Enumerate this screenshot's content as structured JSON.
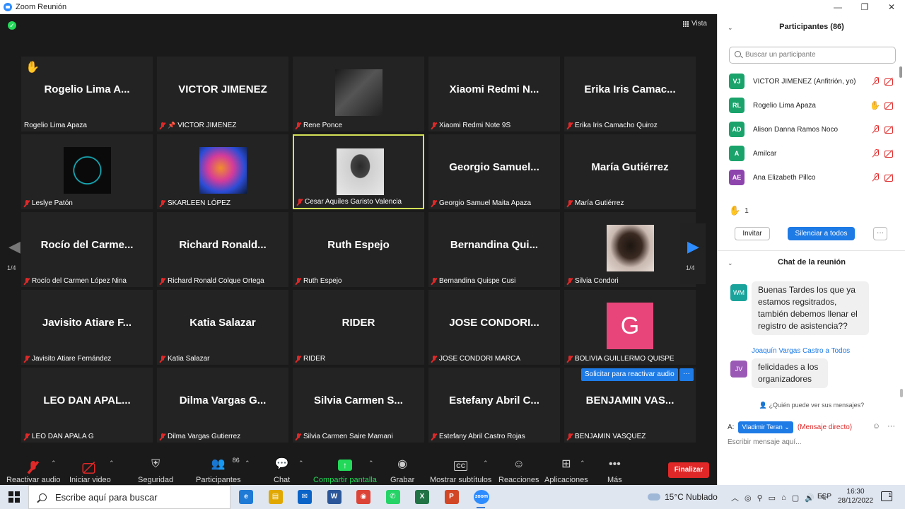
{
  "window": {
    "title": "Zoom Reunión"
  },
  "video": {
    "view_label": "Vista",
    "page_indicator": "1/4",
    "request_unmute_label": "Solicitar para reactivar audio",
    "more_label": "···",
    "tiles": [
      {
        "display": "Rogelio Lima A...",
        "caption": "Rogelio Lima Apaza",
        "muted": false,
        "hand": true
      },
      {
        "display": "VICTOR JIMENEZ",
        "caption": "VICTOR JIMENEZ",
        "muted": true,
        "pinned": true
      },
      {
        "display": "",
        "caption": "Rene Ponce",
        "muted": true,
        "photo": "guitarist"
      },
      {
        "display": "Xiaomi Redmi N...",
        "caption": "Xiaomi Redmi Note 9S",
        "muted": true
      },
      {
        "display": "Erika Iris Camac...",
        "caption": "Erika Iris Camacho Quiroz",
        "muted": true
      },
      {
        "display": "",
        "caption": "Leslye Patón",
        "muted": true,
        "photo": "logo"
      },
      {
        "display": "",
        "caption": "SKARLEEN LÓPEZ",
        "muted": true,
        "photo": "brain"
      },
      {
        "display": "",
        "caption": "Cesar Aquiles Garisto Valencia",
        "muted": true,
        "photo": "portrait",
        "active": true
      },
      {
        "display": "Georgio Samuel...",
        "caption": "Georgio Samuel Maita Apaza",
        "muted": true
      },
      {
        "display": "María Gutiérrez",
        "caption": "María Gutiérrez",
        "muted": true
      },
      {
        "display": "Rocío del Carme...",
        "caption": "Rocío del Carmen López Nina",
        "muted": true
      },
      {
        "display": "Richard  Ronald...",
        "caption": "Richard Ronald Colque Ortega",
        "muted": true
      },
      {
        "display": "Ruth Espejo",
        "caption": "Ruth Espejo",
        "muted": true
      },
      {
        "display": "Bernandina Qui...",
        "caption": "Bernandina Quispe Cusi",
        "muted": true
      },
      {
        "display": "",
        "caption": "Silvia Condori",
        "muted": true,
        "photo": "woman"
      },
      {
        "display": "Javisito  Atiare  F...",
        "caption": "Javisito Atiare Fernández",
        "muted": true
      },
      {
        "display": "Katia Salazar",
        "caption": "Katia Salazar",
        "muted": true
      },
      {
        "display": "RIDER",
        "caption": "RIDER",
        "muted": true
      },
      {
        "display": "JOSE  CONDORI...",
        "caption": "JOSE CONDORI MARCA",
        "muted": true
      },
      {
        "display": "",
        "caption": "BOLIVIA GUILLERMO QUISPE",
        "muted": true,
        "letter": "G"
      },
      {
        "display": "LEO DAN APAL...",
        "caption": "LEO DAN APALA G",
        "muted": true
      },
      {
        "display": "Dilma Vargas G...",
        "caption": "Dilma Vargas Gutierrez",
        "muted": true
      },
      {
        "display": "Silvia Carmen S...",
        "caption": "Silvia Carmen Saire Mamani",
        "muted": true
      },
      {
        "display": "Estefany Abril C...",
        "caption": "Estefany Abril Castro Rojas",
        "muted": true
      },
      {
        "display": "BENJAMIN VAS...",
        "caption": "BENJAMIN VASQUEZ",
        "muted": true
      }
    ]
  },
  "toolbar": {
    "audio": "Reactivar audio",
    "video": "Iniciar video",
    "security": "Seguridad",
    "participants": "Participantes",
    "participants_count": "86",
    "chat": "Chat",
    "share": "Compartir pantalla",
    "record": "Grabar",
    "subtitles": "Mostrar subtítulos",
    "subtitles_icon": "CC",
    "reactions": "Reacciones",
    "apps": "Aplicaciones",
    "more": "Más",
    "more_icon": "•••",
    "end": "Finalizar"
  },
  "participants_panel": {
    "title": "Participantes (86)",
    "search_placeholder": "Buscar un participante",
    "list": [
      {
        "initials": "VJ",
        "name": "VICTOR JIMENEZ (Anfitrión, yo)",
        "color": "#1aa36b",
        "hand": false
      },
      {
        "initials": "RL",
        "name": "Rogelio Lima Apaza",
        "color": "#1aa36b",
        "hand": true
      },
      {
        "initials": "AD",
        "name": "Alison Danna  Ramos Noco",
        "color": "#1aa36b",
        "hand": false
      },
      {
        "initials": "A",
        "name": "Amilcar",
        "color": "#1aa36b",
        "hand": false
      },
      {
        "initials": "AE",
        "name": "Ana Elizabeth Pillco",
        "color": "#8e44ad",
        "hand": false
      },
      {
        "initials": "",
        "name": "",
        "color": "#e67e22",
        "hand": false
      }
    ],
    "raised_hands": "1",
    "invite_label": "Invitar",
    "mute_all_label": "Silenciar a todos",
    "more_label": "···"
  },
  "chat": {
    "title": "Chat de la reunión",
    "messages": [
      {
        "sender": "",
        "initials": "WM",
        "color": "#1aa39b",
        "text": "Buenas Tardes los que ya estamos regsitrados, también debemos llenar el registro de asistencia??"
      },
      {
        "sender": "Joaquín Vargas Castro a Todos",
        "initials": "JV",
        "color": "#9b59b6",
        "text": "felicidades a los organizadores"
      }
    ],
    "who_can_see": "¿Quién puede ver sus mensajes?",
    "to_label": "A:",
    "recipient": "Vladimir Teran",
    "direct_label": "(Mensaje directo)",
    "input_placeholder": "Escribir mensaje aquí..."
  },
  "taskbar": {
    "search_text": "Escribe aquí para buscar",
    "weather": "15°C  Nublado",
    "language": "ESP",
    "time": "16:30",
    "date": "28/12/2022",
    "notifications": "1",
    "apps": [
      {
        "name": "edge",
        "label": "e",
        "color": "#1f7ad6"
      },
      {
        "name": "explorer",
        "label": "▤",
        "color": "#e0a800"
      },
      {
        "name": "mail",
        "label": "✉",
        "color": "#0a64c8"
      },
      {
        "name": "word",
        "label": "W",
        "color": "#2b579a"
      },
      {
        "name": "chrome",
        "label": "◉",
        "color": "#db4437"
      },
      {
        "name": "whatsapp",
        "label": "✆",
        "color": "#25d366"
      },
      {
        "name": "excel",
        "label": "X",
        "color": "#217346"
      },
      {
        "name": "powerpoint",
        "label": "P",
        "color": "#d24726"
      },
      {
        "name": "zoom",
        "label": "zoom",
        "color": "#2d8cff"
      }
    ]
  }
}
